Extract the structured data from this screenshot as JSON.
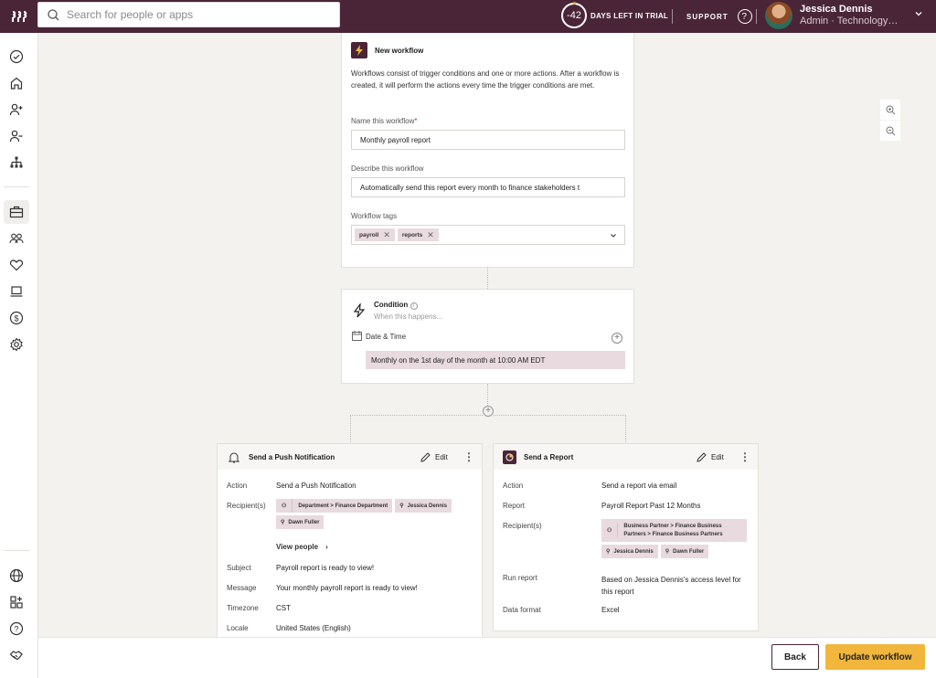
{
  "topbar": {
    "search_placeholder": "Search for people or apps",
    "trial_days": "-42",
    "trial_label": "DAYS LEFT IN TRIAL",
    "support_label": "SUPPORT",
    "help_glyph": "?",
    "user_name": "Jessica Dennis",
    "user_role": "Admin · Technology…",
    "brand_color": "#4a2537"
  },
  "sidebar": {
    "items": [
      {
        "icon": "check-circle-icon"
      },
      {
        "icon": "home-icon"
      },
      {
        "icon": "person-add-icon"
      },
      {
        "icon": "person-remove-icon"
      },
      {
        "icon": "org-chart-icon"
      },
      {
        "icon": "briefcase-icon",
        "active": true
      },
      {
        "icon": "people-icon"
      },
      {
        "icon": "heart-icon"
      },
      {
        "icon": "laptop-icon"
      },
      {
        "icon": "dollar-icon"
      },
      {
        "icon": "gear-icon"
      }
    ],
    "bottom_items": [
      {
        "icon": "globe-icon"
      },
      {
        "icon": "apps-add-icon"
      },
      {
        "icon": "help-icon"
      },
      {
        "icon": "handshake-icon"
      }
    ]
  },
  "workflow": {
    "title": "New workflow",
    "description": "Workflows consist of trigger conditions and one or more actions. After a workflow is created, it will perform the actions every time the trigger conditions are met.",
    "name_label": "Name this workflow",
    "required_mark": "*",
    "name_value": "Monthly payroll report",
    "describe_label": "Describe this workflow",
    "describe_value": "Automatically send this report every month to finance stakeholders t",
    "tags_label": "Workflow tags",
    "tags": [
      "payroll",
      "reports"
    ]
  },
  "condition": {
    "title": "Condition",
    "subtitle": "When this happens...",
    "type": "Date & Time",
    "value": "Monthly on the 1st day of the month at 10:00 AM EDT"
  },
  "actions": [
    {
      "title": "Send a Push Notification",
      "edit_label": "Edit",
      "rows": [
        {
          "label": "Action",
          "value": "Send a Push Notification"
        },
        {
          "label": "Recipient(s)"
        },
        {
          "label": "Subject",
          "value": "Payroll report is ready to view!"
        },
        {
          "label": "Message",
          "value": "Your monthly payroll report is ready to view!"
        },
        {
          "label": "Timezone",
          "value": "CST"
        },
        {
          "label": "Locale",
          "value": "United States (English)"
        }
      ],
      "recipients": [
        "Department > Finance Department",
        "Jessica Dennis",
        "Dawn Fuller"
      ],
      "view_people": "View people"
    },
    {
      "title": "Send a Report",
      "edit_label": "Edit",
      "rows": [
        {
          "label": "Action",
          "value": "Send a report via email"
        },
        {
          "label": "Report",
          "value": "Payroll Report Past 12 Months"
        },
        {
          "label": "Recipient(s)"
        },
        {
          "label": "Run report",
          "value": "Based on Jessica Dennis's access level for this report"
        },
        {
          "label": "Data format",
          "value": "Excel"
        }
      ],
      "recipients": [
        "Business Partner > Finance Business Partners > Finance Business Partners",
        "Jessica Dennis",
        "Dawn Fuller"
      ]
    }
  ],
  "footer": {
    "back_label": "Back",
    "update_label": "Update workflow",
    "accent_color": "#f2b63d"
  }
}
